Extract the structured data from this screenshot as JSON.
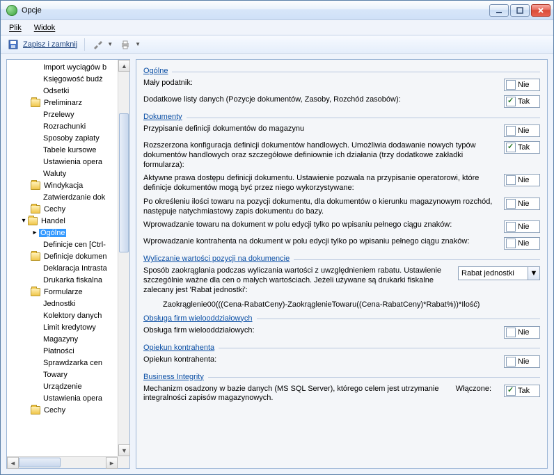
{
  "window": {
    "title": "Opcje"
  },
  "menu": {
    "file": "Plik",
    "view": "Widok"
  },
  "toolbar": {
    "save_close": "Zapisz i zamknij"
  },
  "tree": {
    "items": [
      {
        "label": "Import wyciągów b",
        "depth": 2,
        "folder": false
      },
      {
        "label": "Księgowość budż",
        "depth": 2,
        "folder": false
      },
      {
        "label": "Odsetki",
        "depth": 2,
        "folder": false
      },
      {
        "label": "Preliminarz",
        "depth": 1,
        "folder": true
      },
      {
        "label": "Przelewy",
        "depth": 2,
        "folder": false
      },
      {
        "label": "Rozrachunki",
        "depth": 2,
        "folder": false
      },
      {
        "label": "Sposoby zapłaty",
        "depth": 2,
        "folder": false
      },
      {
        "label": "Tabele kursowe",
        "depth": 2,
        "folder": false
      },
      {
        "label": "Ustawienia opera",
        "depth": 2,
        "folder": false
      },
      {
        "label": "Waluty",
        "depth": 2,
        "folder": false
      },
      {
        "label": "Windykacja",
        "depth": 1,
        "folder": true
      },
      {
        "label": "Zatwierdzanie dok",
        "depth": 2,
        "folder": false
      },
      {
        "label": "Cechy",
        "depth": 1,
        "folder": true
      },
      {
        "label": "Handel",
        "depth": 0,
        "folder": true,
        "expander": "▾"
      },
      {
        "label": "Ogólne",
        "depth": 1,
        "folder": false,
        "expander": "▸",
        "selected": true
      },
      {
        "label": "Definicje cen [Ctrl-",
        "depth": 2,
        "folder": false
      },
      {
        "label": "Definicje dokumen",
        "depth": 1,
        "folder": true
      },
      {
        "label": "Deklaracja Intrasta",
        "depth": 2,
        "folder": false
      },
      {
        "label": "Drukarka fiskalna",
        "depth": 2,
        "folder": false
      },
      {
        "label": "Formularze",
        "depth": 1,
        "folder": true
      },
      {
        "label": "Jednostki",
        "depth": 2,
        "folder": false
      },
      {
        "label": "Kolektory danych",
        "depth": 2,
        "folder": false
      },
      {
        "label": "Limit kredytowy",
        "depth": 2,
        "folder": false
      },
      {
        "label": "Magazyny",
        "depth": 2,
        "folder": false
      },
      {
        "label": "Płatności",
        "depth": 2,
        "folder": false
      },
      {
        "label": "Sprawdzarka cen",
        "depth": 2,
        "folder": false
      },
      {
        "label": "Towary",
        "depth": 2,
        "folder": false
      },
      {
        "label": "Urządzenie",
        "depth": 2,
        "folder": false
      },
      {
        "label": "Ustawienia opera",
        "depth": 2,
        "folder": false
      },
      {
        "label": "Cechy",
        "depth": 1,
        "folder": true
      }
    ]
  },
  "sections": {
    "ogolne": {
      "title": "Ogólne",
      "opt1": {
        "label": "Mały podatnik:",
        "value": "Nie"
      },
      "opt2": {
        "label": "Dodatkowe listy danych (Pozycje dokumentów, Zasoby, Rozchód zasobów):",
        "value": "Tak"
      }
    },
    "dokumenty": {
      "title": "Dokumenty",
      "opt1": {
        "label": "Przypisanie definicji dokumentów do magazynu",
        "value": "Nie"
      },
      "opt2": {
        "label": "Rozszerzona konfiguracja definicji dokumentów handlowych. Umożliwia dodawanie nowych typów dokumentów handlowych oraz szczegółowe definiownie ich działania (trzy dodatkowe zakładki formularza):",
        "value": "Tak"
      },
      "opt3": {
        "label": "Aktywne prawa dostępu definicji dokumentu. Ustawienie pozwala na przypisanie operatorowi, które definicje dokumentów mogą być przez niego wykorzystywane:",
        "value": "Nie"
      },
      "opt4": {
        "label": "Po określeniu ilości towaru na pozycji dokumentu, dla dokumentów o kierunku magazynowym rozchód,  następuje natychmiastowy zapis dokumentu do bazy.",
        "value": "Nie"
      },
      "opt5": {
        "label": "Wprowadzanie towaru na dokument w polu edycji tylko po wpisaniu pełnego ciągu znaków:",
        "value": "Nie"
      },
      "opt6": {
        "label": "Wprowadzanie kontrahenta na dokument w polu edycji tylko po wpisaniu pełnego ciągu znaków:",
        "value": "Nie"
      }
    },
    "wyliczanie": {
      "title": "Wyliczanie wartości pozycji na dokumencie",
      "desc": "Sposób zaokrąglania podczas wyliczania wartości z uwzględnieniem rabatu. Ustawienie szczególnie ważne dla cen o małych wartościach. Jeżeli używane są drukarki fiskalne zalecany jest 'Rabat jednostki':",
      "dropdown": "Rabat jednostki",
      "formula": "Zaokrąglenie00(((Cena-RabatCeny)-ZaokrąglenieTowaru((Cena-RabatCeny)*Rabat%))*Ilość)"
    },
    "obsluga": {
      "title": "Obsługa firm wielooddziałowych",
      "opt1": {
        "label": "Obsługa firm wielooddziałowych:",
        "value": "Nie"
      }
    },
    "opiekun": {
      "title": "Opiekun kontrahenta",
      "opt1": {
        "label": "Opiekun kontrahenta:",
        "value": "Nie"
      }
    },
    "bi": {
      "title": "Business Integrity",
      "opt1": {
        "label": "Mechanizm osadzony w bazie danych (MS SQL Server), którego celem jest utrzymanie integralności zapisów magazynowych.",
        "extra": "Włączone:",
        "value": "Tak"
      }
    }
  }
}
